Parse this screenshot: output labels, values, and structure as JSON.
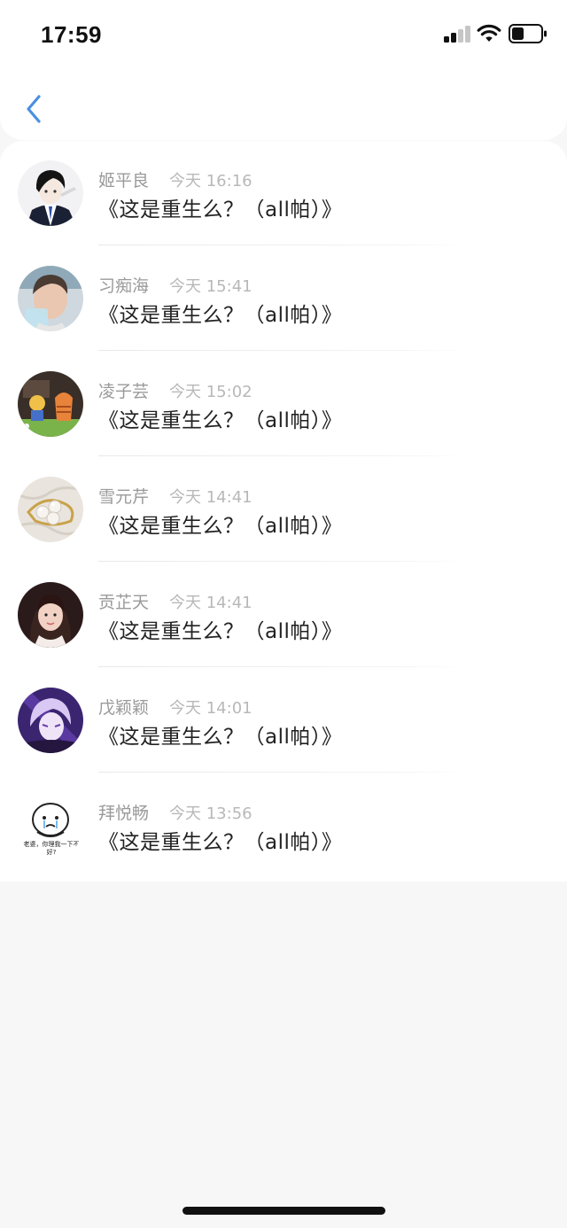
{
  "status_bar": {
    "time": "17:59",
    "signal_icon": "cellular-signal-icon",
    "wifi_icon": "wifi-icon",
    "battery_icon": "battery-icon"
  },
  "header": {
    "back_icon": "chevron-left-icon",
    "accent_color": "#4a90e2"
  },
  "items": [
    {
      "name": "姬平良",
      "time": "今天 16:16",
      "title": "《这是重生么？（all帕）》",
      "avatar_icon": "anime-boy-avatar"
    },
    {
      "name": "习痴海",
      "time": "今天 15:41",
      "title": "《这是重生么？（all帕）》",
      "avatar_icon": "photo-avatar"
    },
    {
      "name": "凌子芸",
      "time": "今天 15:02",
      "title": "《这是重生么？（all帕）》",
      "avatar_icon": "cartoon-avatar"
    },
    {
      "name": "雪元芹",
      "time": "今天 14:41",
      "title": "《这是重生么？（all帕）》",
      "avatar_icon": "pearl-brooch-avatar"
    },
    {
      "name": "贡芷天",
      "time": "今天 14:41",
      "title": "《这是重生么？（all帕）》",
      "avatar_icon": "girl-portrait-avatar"
    },
    {
      "name": "戊颖颖",
      "time": "今天 14:01",
      "title": "《这是重生么？（all帕）》",
      "avatar_icon": "anime-purple-avatar"
    },
    {
      "name": "拜悦畅",
      "time": "今天 13:56",
      "title": "《这是重生么？（all帕）》",
      "avatar_icon": "meme-avatar",
      "avatar_caption": "老婆，你理我一下不好?"
    }
  ]
}
